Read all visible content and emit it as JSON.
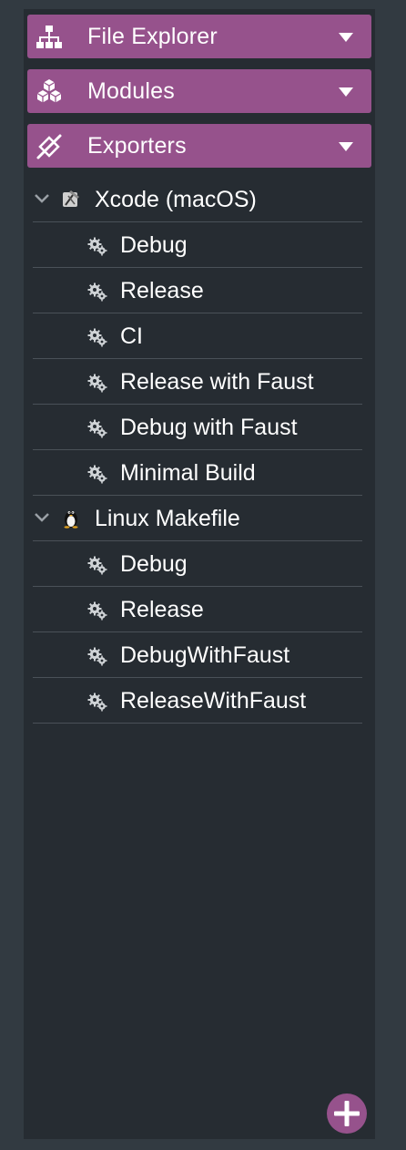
{
  "sections": [
    {
      "label": "File Explorer",
      "icon": "hierarchy-icon"
    },
    {
      "label": "Modules",
      "icon": "cubes-icon"
    },
    {
      "label": "Exporters",
      "icon": "exporters-icon"
    }
  ],
  "exporters": [
    {
      "label": "Xcode (macOS)",
      "icon": "xcode-icon",
      "configs": [
        "Debug",
        "Release",
        "CI",
        "Release with Faust",
        "Debug with Faust",
        "Minimal Build"
      ]
    },
    {
      "label": "Linux Makefile",
      "icon": "linux-tux-icon",
      "configs": [
        "Debug",
        "Release",
        "DebugWithFaust",
        "ReleaseWithFaust"
      ]
    }
  ],
  "add_button": {
    "icon": "plus-icon"
  },
  "colors": {
    "accent": "#96528c",
    "panel": "#262c32",
    "background": "#323a41",
    "divider": "#4a5158",
    "text": "#ffffff"
  }
}
